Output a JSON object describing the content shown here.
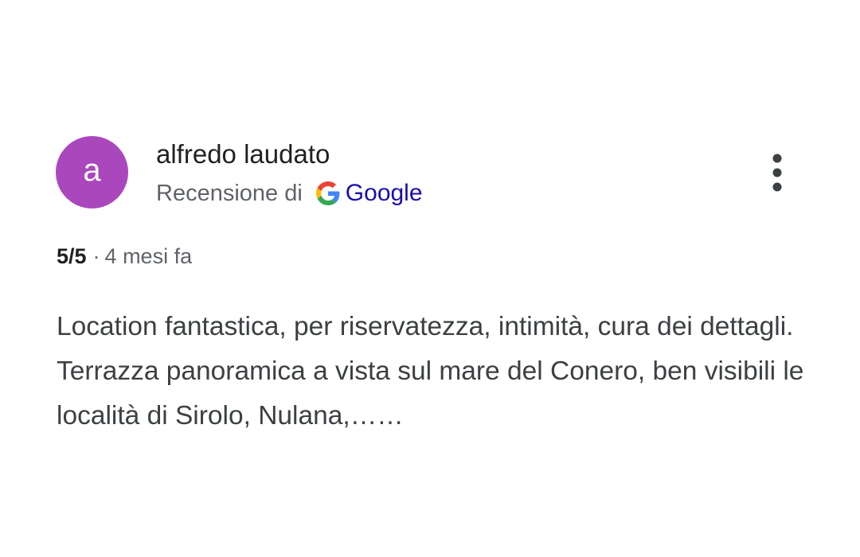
{
  "review": {
    "avatar_initial": "a",
    "avatar_color": "#ab47bc",
    "author": "alfredo laudato",
    "source_prefix": "Recensione di",
    "source_name": "Google",
    "source_icon": "google-g-icon",
    "more_icon": "more-vert-icon",
    "rating": "5/5",
    "separator": "·",
    "age": "4 mesi fa",
    "text": "Location fantastica, per riservatezza, intimità, cura dei dettagli. Terrazza panoramica a vista sul mare del Conero, ben visibili le località di Sirolo, Nulana,……"
  }
}
